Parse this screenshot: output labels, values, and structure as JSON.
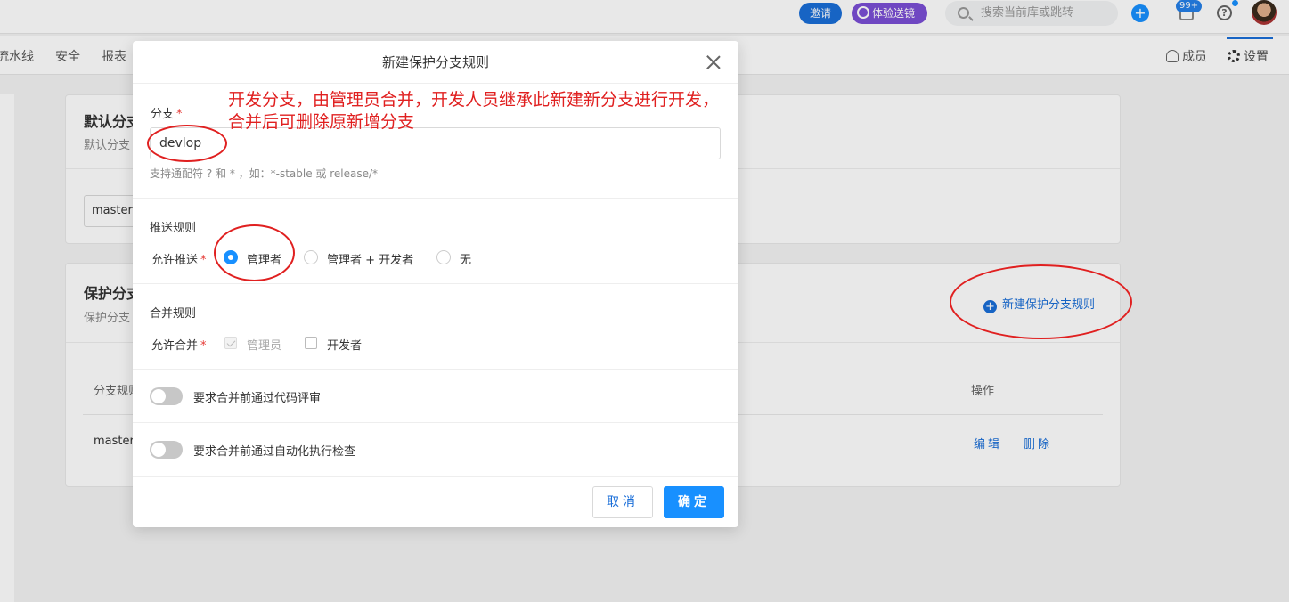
{
  "topbar": {
    "invite_label": "邀请",
    "experience_label": "体验送镜",
    "search_placeholder": "搜索当前库或跳转",
    "notification_badge": "99+",
    "help_icon": "?"
  },
  "subnav": {
    "items": [
      "流水线",
      "安全",
      "报表"
    ],
    "member_label": "成员",
    "settings_label": "设置"
  },
  "default_branch_card": {
    "title": "默认分支",
    "subtitle": "默认分支",
    "branch_value": "master"
  },
  "protected_branch_card": {
    "title": "保护分支",
    "subtitle": "保护分支",
    "new_rule_label": "新建保护分支规则",
    "table": {
      "col_branch": "分支规则",
      "col_actions": "操作",
      "rows": [
        {
          "branch": "master",
          "edit": "编辑",
          "delete": "删除"
        }
      ]
    }
  },
  "modal": {
    "title": "新建保护分支规则",
    "branch_label": "分支",
    "branch_value": "devlop",
    "branch_hint": "支持通配符 ? 和 * ，如：*-stable 或 release/*",
    "push_section": "推送规则",
    "push_label": "允许推送",
    "push_options": [
      "管理者",
      "管理者 + 开发者",
      "无"
    ],
    "push_selected": "管理者",
    "merge_section": "合并规则",
    "merge_label": "允许合并",
    "merge_options": [
      "管理员",
      "开发者"
    ],
    "toggle_review": "要求合并前通过代码评审",
    "toggle_ci": "要求合并前通过自动化执行检查",
    "cancel_label": "取消",
    "ok_label": "确定"
  },
  "annotation": {
    "line1": "开发分支，由管理员合并，开发人员继承此新建新分支进行开发，",
    "line2": "合并后可删除原新增分支",
    "color": "#e02020"
  },
  "colors": {
    "accent": "#1890ff",
    "link": "#1a6ed8",
    "required": "#e53935"
  }
}
